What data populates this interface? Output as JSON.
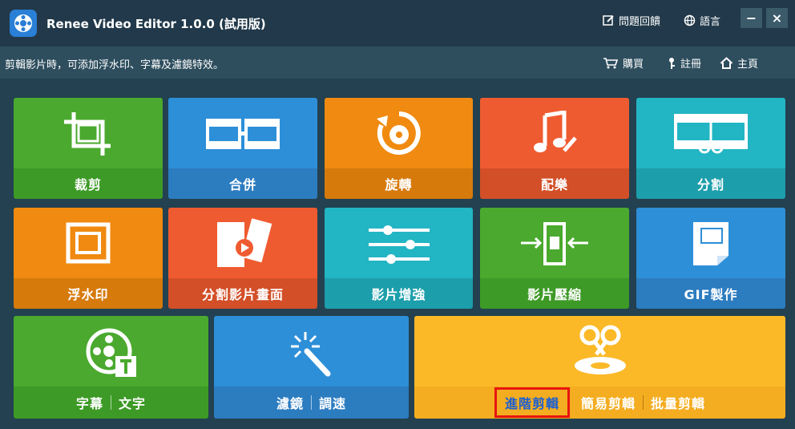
{
  "titlebar": {
    "app_title": "Renee Video Editor 1.0.0 (試用版)",
    "feedback": "問題回饋",
    "language": "語言",
    "minimize": "−",
    "close": "×"
  },
  "subbar": {
    "hint": "剪輯影片時，可添加浮水印、字幕及濾鏡特效。",
    "buy": "購買",
    "register": "註冊",
    "home": "主頁"
  },
  "tiles": {
    "crop": "裁剪",
    "merge": "合併",
    "rotate": "旋轉",
    "music": "配樂",
    "split": "分割",
    "watermark": "浮水印",
    "split_screen": "分割影片畫面",
    "enhance": "影片增強",
    "compress": "影片壓縮",
    "gif": "GIF製作",
    "subtitle": "字幕",
    "text": "文字",
    "filter": "濾鏡",
    "speed": "調速",
    "advanced": "進階剪輯",
    "simple": "簡易剪輯",
    "batch": "批量剪輯"
  },
  "colors": {
    "green": "#4aa92e",
    "blue": "#2d8fd8",
    "orange": "#f08a10",
    "red": "#ef5b30",
    "teal": "#22b5c3",
    "yellow": "#fbb928"
  }
}
